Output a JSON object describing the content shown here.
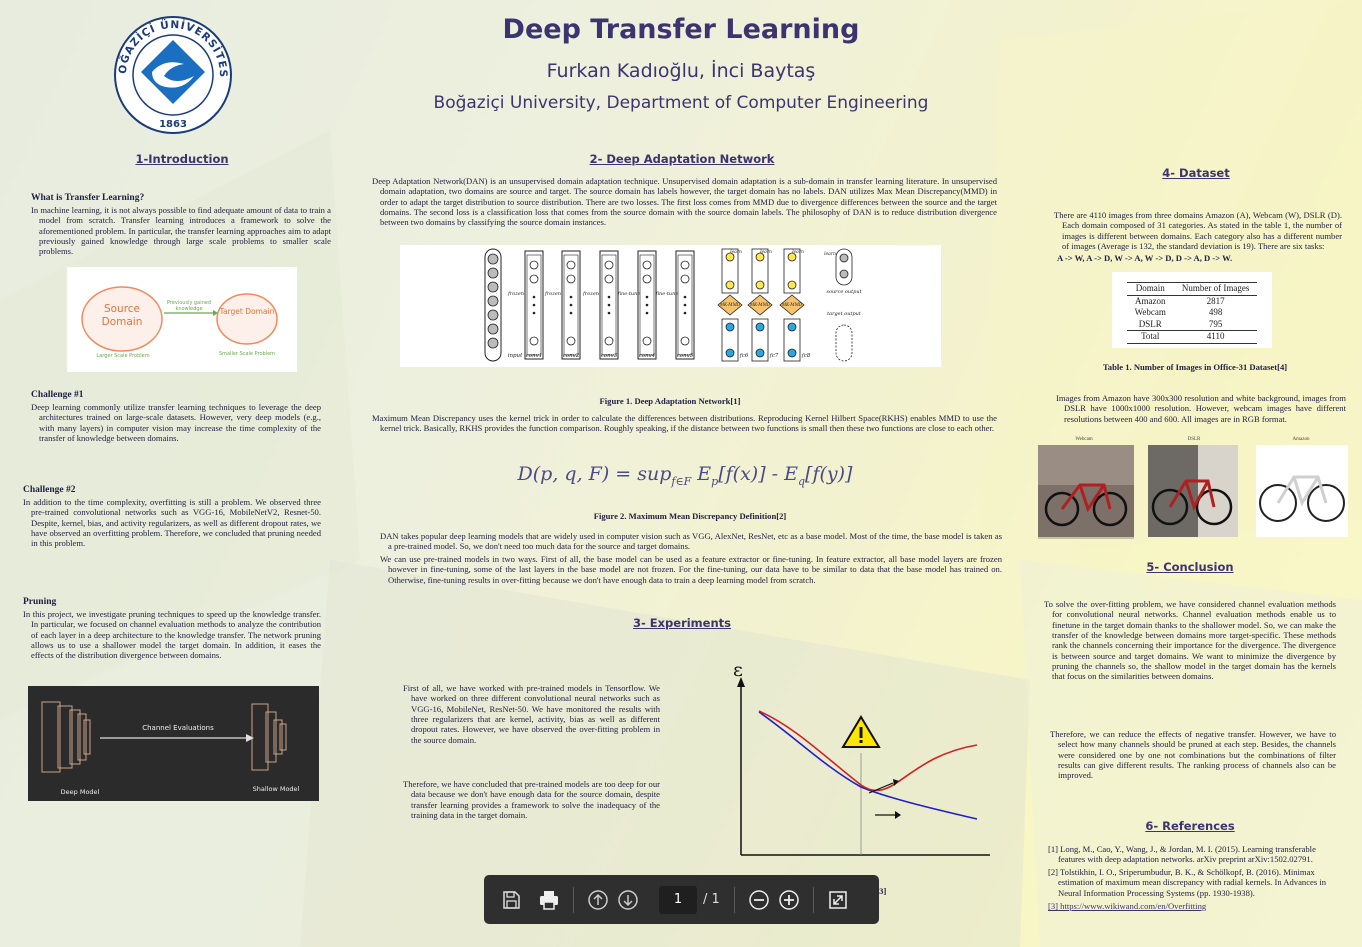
{
  "header": {
    "title": "Deep Transfer Learning",
    "authors": "Furkan Kadıoğlu, İnci Baytaş",
    "affiliation": "Boğaziçi University, Department of Computer Engineering"
  },
  "logo": {
    "text": "BOĞAZİÇİ ÜNİVERSİTESİ",
    "year": "1863"
  },
  "intro": {
    "heading": "1-Introduction",
    "what_title": "What is Transfer Learning?",
    "what_text": "In machine learning, it is not always possible to find adequate amount of data to train a model from scratch. Transfer learning introduces a framework to solve the aforementioned problem. In particular, the transfer learning approaches aim to adapt previously gained knowledge through large scale problems to smaller scale problems.",
    "fig": {
      "source": "Source Domain",
      "target": "Target Domain",
      "arrow": "Previously gained knowledge",
      "left_label": "Larger Scale Problem",
      "right_label": "Smaller Scale Problem"
    },
    "ch1_title": "Challenge #1",
    "ch1_text": "Deep learning commonly utilize transfer learning techniques to leverage the deep architectures trained on large-scale datasets. However, very deep models (e.g., with many layers) in computer vision may increase the time complexity of the transfer of knowledge between domains.",
    "ch2_title": "Challenge #2",
    "ch2_text": "In addition to the time complexity, overfitting is still a problem. We observed three pre-trained convolutional networks such as VGG-16, MobileNetV2, Resnet-50. Despite, kernel, bias, and activity regularizers, as well as different dropout rates, we have observed an overfitting problem. Therefore, we concluded that pruning needed in this problem.",
    "pruning_title": "Pruning",
    "pruning_text": "In this project, we investigate pruning techniques to speed up the knowledge transfer. In particular, we focused on channel evaluation methods to analyze the contribution of each layer in a deep architecture to the knowledge transfer. The network pruning allows us to use a shallower model the target domain. In addition, it eases the effects of the distribution divergence between domains.",
    "pruning_fig": {
      "arrow_label": "Channel Evaluations",
      "deep": "Deep Model",
      "shallow": "Shallow Model"
    }
  },
  "dan": {
    "heading": "2- Deep Adaptation Network",
    "text1": "Deep Adaptation Network(DAN) is an unsupervised domain adaptation technique. Unsupervised domain adaptation is a sub-domain in transfer learning literature. In unsupervised domain adaptation, two domains are source and target. The source domain has labels however, the target domain has no labels. DAN utilizes Max Mean Discrepancy(MMD) in order to adapt the target distribution to source distribution. There are two losses. The first loss comes from MMD due to divergence differences between the source and the target domains. The second loss is a classification loss that comes from the source domain with the source domain labels. The philosophy of DAN is to reduce distribution divergence between two domains by classifying the source domain instances.",
    "fig_labels": {
      "frozen": "frozen",
      "finetune": "fine-tune",
      "learn": "learn",
      "mkmmd": "MK-MMD",
      "input": "input",
      "conv1": "conv1",
      "conv2": "conv2",
      "conv3": "conv3",
      "conv4": "conv4",
      "conv5": "conv5",
      "fc6": "fc6",
      "fc7": "fc7",
      "fc8": "fc8",
      "source_output": "source output",
      "target_output": "target output"
    },
    "fig1_caption": "Figure 1. Deep Adaptation Network[1]",
    "text2": "Maximum Mean Discrepancy uses the kernel trick in order to calculate the differences between distributions. Reproducing Kernel Hilbert Space(RKHS) enables MMD to use the kernel trick. Basically, RKHS provides the function comparison. Roughly speaking, if the distance between two functions is small then these two functions are close to each other.",
    "formula": "D(p, q, F) = sup_f∈F E_p[f(x)] - E_q[f(y)]",
    "fig2_caption": "Figure 2. Maximum Mean Discrepancy Definition[2]",
    "text3": "DAN takes popular deep learning models that are widely used in computer vision such as VGG, AlexNet, ResNet, etc as a base model. Most of the time, the base model is taken as a pre-trained model. So, we don't need too much data for the source and target domains.",
    "text4": "We can use pre-trained models in two ways. First of all, the base model can be used as a feature extractor or fine-tuning. In feature extractor, all base model layers are frozen however in fine-tuning, some of the last layers in the base model are not frozen. For the fine-tuning, our data have to be similar to data that the base model has trained on. Otherwise, fine-tuning results in over-fitting because we don't have enough data to train a deep learning model from scratch."
  },
  "experiments": {
    "heading": "3- Experiments",
    "text1": "First of all, we have worked with pre-trained models in Tensorflow. We have worked on three different convolutional neural networks such as VGG-16, MobileNet, ResNet-50. We have monitored the results with three regularizers that are kernel, activity, bias as well as different dropout rates. However, we have observed the over-fitting problem in the source domain.",
    "text2": "Therefore, we have concluded that pre-trained models are too deep for our data because we don't have enough data for the source domain, despite transfer learning provides a framework to solve the inadequacy of the training data in the target domain.",
    "plot_axis": "ε",
    "fig3_caption_tail": "g[3]"
  },
  "dataset": {
    "heading": "4- Dataset",
    "text1": "There are 4110 images from three domains Amazon (A), Webcam (W), DSLR (D). Each domain composed of 31 categories. As stated in the table 1, the number of images is different between domains. Each category also has a different number of images (Average is 132, the standard deviation is 19). There are six tasks:",
    "tasks": "A -> W, A -> D, W -> A, W -> D, D -> A, D -> W.",
    "table": {
      "headers": [
        "Domain",
        "Number of Images"
      ],
      "rows": [
        [
          "Amazon",
          "2817"
        ],
        [
          "Webcam",
          "498"
        ],
        [
          "DSLR",
          "795"
        ]
      ],
      "total": [
        "Total",
        "4110"
      ]
    },
    "table_caption": "Table 1. Number of Images in Office-31 Dataset[4]",
    "text2": "Images from Amazon have 300x300 resolution and white background, images from DSLR have 1000x1000 resolution. However, webcam images have different resolutions between 400 and 600. All images are in RGB format.",
    "img_titles": [
      "Webcam",
      "DSLR",
      "Amazon"
    ]
  },
  "conclusion": {
    "heading": "5- Conclusion",
    "text1": "To solve the over-fitting problem, we have considered channel evaluation methods for convolutional neural networks. Channel evaluation methods enable us to finetune in the target domain thanks to the shallower model. So, we can make the transfer of the knowledge between domains more target-specific. These methods rank the channels concerning their importance for the divergence. The divergence is between source and target domains. We want to minimize the divergence by pruning the channels so, the shallow model in the target domain has the kernels that focus on the similarities between domains.",
    "text2": "Therefore, we can reduce the effects of negative transfer. However, we have to select how many channels should be pruned at each step. Besides, the channels were considered one by one not combinations but the combinations of filter results can give different results. The ranking process of channels also can be improved."
  },
  "references": {
    "heading": "6- References",
    "items": [
      "[1] Long, M., Cao, Y., Wang, J., & Jordan, M. I. (2015). Learning transferable features with deep adaptation networks. arXiv preprint arXiv:1502.02791.",
      "[2] Tolstikhin, I. O., Sriperumbudur, B. K., & Schölkopf, B. (2016). Minimax estimation of maximum mean discrepancy with radial kernels. In Advances in Neural Information Processing Systems (pp. 1930-1938).",
      "[3] https://www.wikiwand.com/en/Overfitting"
    ]
  },
  "toolbar": {
    "page": "1",
    "total": "/ 1"
  },
  "colors": {
    "heading": "#3b3470",
    "body_text": "#222244",
    "source_curve": "#d42020",
    "target_curve": "#2020c8"
  }
}
